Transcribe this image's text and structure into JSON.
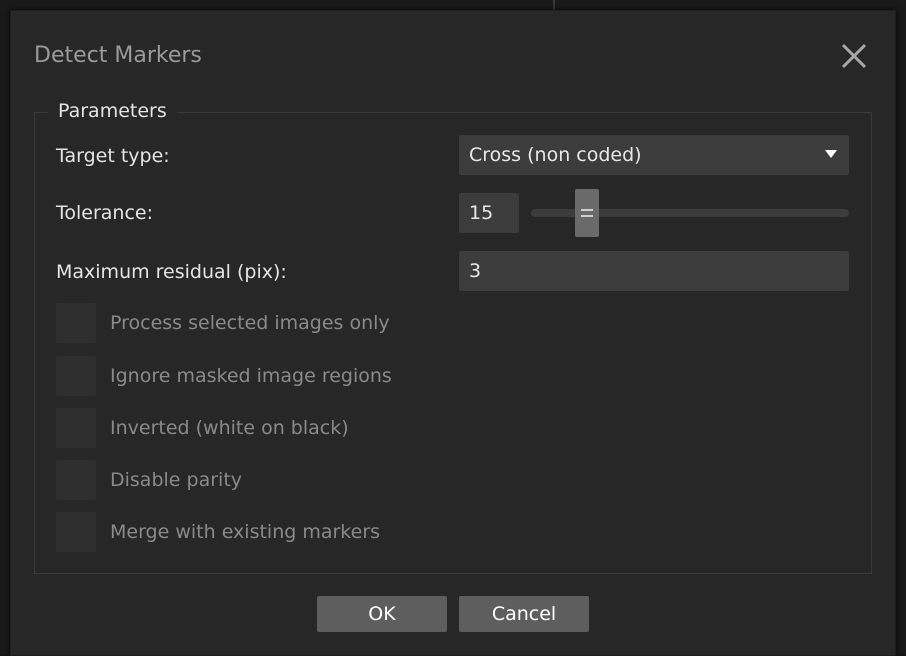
{
  "dialog": {
    "title": "Detect Markers",
    "close_icon": "close-icon"
  },
  "parameters": {
    "legend": "Parameters",
    "target_type": {
      "label": "Target type:",
      "value": "Cross (non coded)"
    },
    "tolerance": {
      "label": "Tolerance:",
      "value": "15",
      "slider_fraction": 0.15
    },
    "max_residual": {
      "label": "Maximum residual (pix):",
      "value": "3"
    },
    "checkboxes": [
      {
        "label": "Process selected images only",
        "checked": false,
        "enabled": false
      },
      {
        "label": "Ignore masked image regions",
        "checked": false,
        "enabled": false
      },
      {
        "label": "Inverted (white on black)",
        "checked": false,
        "enabled": false
      },
      {
        "label": "Disable parity",
        "checked": false,
        "enabled": false
      },
      {
        "label": "Merge with existing markers",
        "checked": false,
        "enabled": false
      }
    ]
  },
  "buttons": {
    "ok": "OK",
    "cancel": "Cancel"
  },
  "colors": {
    "dialog_bg": "#272727",
    "field_bg": "#3c3c3c",
    "button_bg": "#5e5e5e",
    "text": "#e4e4e4",
    "disabled_text": "#8a8a8a"
  }
}
